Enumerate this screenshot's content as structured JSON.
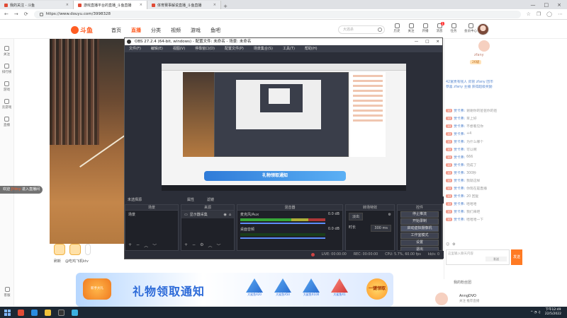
{
  "browser": {
    "tabs": [
      {
        "label": "我的关注 - 斗鱼",
        "active": false
      },
      {
        "label": "游戏直播平台的直播_斗鱼直播",
        "active": true
      },
      {
        "label": "体育赛事解说直播_斗鱼直播",
        "active": false
      }
    ],
    "url": "https://www.douyu.com/3998328"
  },
  "header": {
    "logo": "斗鱼",
    "nav": [
      "首页",
      "直播",
      "分类",
      "视频",
      "游戏",
      "鱼吧"
    ],
    "active_nav": "直播",
    "search_placeholder": "大逃杀",
    "icons": [
      {
        "label": "历史",
        "icon": "history-icon"
      },
      {
        "label": "关注",
        "icon": "follow-icon"
      },
      {
        "label": "开播",
        "icon": "broadcast-icon"
      },
      {
        "label": "消息",
        "icon": "message-icon",
        "badge": "1"
      },
      {
        "label": "任务",
        "icon": "task-icon"
      },
      {
        "label": "会员中心",
        "icon": "vip-icon"
      }
    ]
  },
  "sidebar": {
    "items": [
      "关注",
      "排行榜",
      "游戏",
      "云游戏",
      "直播"
    ],
    "bottom": "客服"
  },
  "stream": {
    "welcome_user": "欢迎",
    "welcome_name": "JYdny",
    "welcome_text": "进入直播间",
    "controls": [
      "刷新",
      "@吃鸡飞机ktv"
    ]
  },
  "obs": {
    "title": "OBS 27.2.4 (64-bit, windows) - 配置文件: 未命名 - 场景: 未命名",
    "menu": [
      "文件(F)",
      "编辑(E)",
      "视图(V)",
      "停靠窗口(D)",
      "配置文件(P)",
      "场景集合(S)",
      "工具(T)",
      "帮助(H)"
    ],
    "dock_titles": [
      "场景",
      "来源",
      "混音器",
      "转场特效",
      "控件"
    ],
    "no_source": "未选择源",
    "filter_label": "属性",
    "filter2": "滤镜",
    "scenes": [
      "场景"
    ],
    "sources": [
      "显示器采集"
    ],
    "mixer": [
      {
        "name": "桌面音频",
        "db": "0.0 dB"
      },
      {
        "name": "麦克风/Aux",
        "db": "0.0 dB"
      }
    ],
    "transition": {
      "type": "淡出",
      "duration_label": "时长",
      "duration": "300 ms"
    },
    "controls": [
      "停止推流",
      "开始录制",
      "启动虚拟摄像机",
      "工作室模式",
      "设置",
      "退出"
    ],
    "status": [
      "LIVE: 00:00:00",
      "REC: 00:00:00",
      "CPU: 5.7%, 60.00 fps",
      "kb/s: 0"
    ],
    "preview_banner": "礼物领取通知"
  },
  "chat": {
    "anchor_name": "zfany",
    "fans_badge": "26级",
    "system_msgs": [
      "42富贵有钱人 房管 zfany 团币",
      "恭喜 zfany 主播 获得超级奖励"
    ],
    "messages": [
      {
        "level": "10",
        "user": "贾卡弗:",
        "text": "谢谢你的爸爸你的爸"
      },
      {
        "level": "10",
        "user": "贾卡弗:",
        "text": "早上好"
      },
      {
        "level": "10",
        "user": "贾卡弗:",
        "text": "不想看见你"
      },
      {
        "level": "10",
        "user": "贾卡弗:",
        "text": "+4"
      },
      {
        "level": "10",
        "user": "贾卡弗:",
        "text": "为什么哪个"
      },
      {
        "level": "10",
        "user": "贾卡弗:",
        "text": "可以啊"
      },
      {
        "level": "10",
        "user": "贾卡弗:",
        "text": "666"
      },
      {
        "level": "10",
        "user": "贾卡弗:",
        "text": "完成了"
      },
      {
        "level": "10",
        "user": "贾卡弗:",
        "text": "300秒"
      },
      {
        "level": "10",
        "user": "贾卡弗:",
        "text": "我就这样"
      },
      {
        "level": "10",
        "user": "贾卡弗:",
        "text": "你现在是直播"
      },
      {
        "level": "10",
        "user": "贾卡弗:",
        "text": "20 回复"
      },
      {
        "level": "10",
        "user": "贾卡弗:",
        "text": "哈哈哈"
      },
      {
        "level": "10",
        "user": "贾卡弗:",
        "text": "我们来吧"
      },
      {
        "level": "10",
        "user": "贾卡弗:",
        "text": "哈哈哈一下"
      }
    ],
    "input_placeholder": "这里输入聊天内容",
    "send": "发送",
    "inner_send": "发送",
    "gift_section": "我的粉丝团"
  },
  "banner": {
    "title": "礼物领取通知",
    "items": [
      "大鲨鱼X20",
      "大鲨鱼X50",
      "大鲨鱼X100",
      "大鲨鱼X1"
    ],
    "left_label": "新手大礼",
    "receive": "一键领取"
  },
  "host": {
    "name": "AnngDVO",
    "sub": "关注 推荐直播"
  },
  "taskbar": {
    "time": "下午12:49",
    "date": "22/5/2022"
  }
}
